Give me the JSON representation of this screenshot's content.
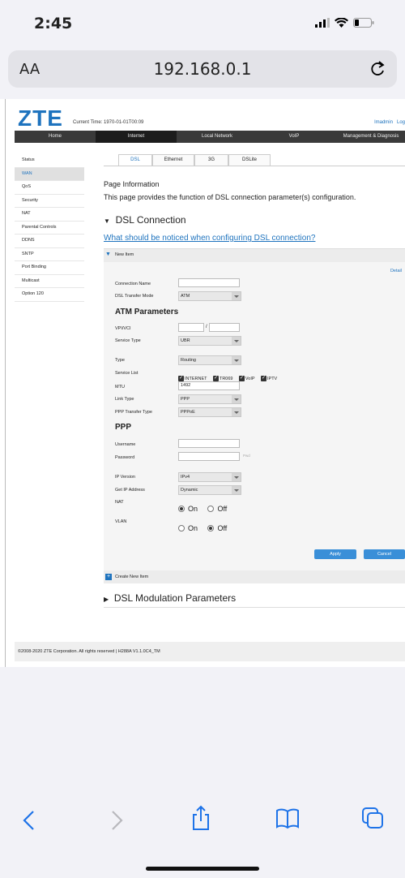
{
  "status": {
    "time": "2:45"
  },
  "browser": {
    "aa_label": "AA",
    "url": "192.168.0.1"
  },
  "header": {
    "logo": "ZTE",
    "current_time": "Current Time: 1970-01-01T00:09",
    "user": "lmadmin",
    "logout": "Log"
  },
  "nav": [
    {
      "label": "Home",
      "active": false
    },
    {
      "label": "Internet",
      "active": true
    },
    {
      "label": "Local Network",
      "active": false
    },
    {
      "label": "VoIP",
      "active": false
    },
    {
      "label": "Management & Diagnosis",
      "active": false
    }
  ],
  "sidebar": [
    "Status",
    "WAN",
    "QoS",
    "Security",
    "NAT",
    "Parental Controls",
    "DDNS",
    "SNTP",
    "Port Binding",
    "Multicast",
    "Option 120"
  ],
  "sidebar_active": "WAN",
  "tabs": [
    "DSL",
    "Ethernet",
    "3G",
    "DSLite"
  ],
  "page_info": {
    "title": "Page Information",
    "desc": "This page provides the function of DSL connection parameter(s) configuration."
  },
  "dsl_connection": {
    "title": "DSL Connection",
    "link": "What should be noticed when configuring DSL connection?"
  },
  "new_item": {
    "label": "New Item",
    "detail": "Detail"
  },
  "form": {
    "connection_name_label": "Connection Name",
    "connection_name_value": "",
    "dsl_mode_label": "DSL Transfer Mode",
    "dsl_mode_value": "ATM",
    "atm_title": "ATM Parameters",
    "vpivci_label": "VPI/VCI",
    "vpivci_sep": "/",
    "service_type_label": "Service Type",
    "service_type_value": "UBR",
    "type_label": "Type",
    "type_value": "Routing",
    "service_list_label": "Service List",
    "service_list": [
      "INTERNET",
      "TR069",
      "VoIP",
      "IPTV"
    ],
    "mtu_label": "MTU",
    "mtu_value": "1492",
    "link_type_label": "Link Type",
    "link_type_value": "PPP",
    "ppp_transfer_label": "PPP Transfer Type",
    "ppp_transfer_value": "PPPoE",
    "ppp_title": "PPP",
    "username_label": "Username",
    "password_label": "Password",
    "password_hint": "Pwd",
    "ip_version_label": "IP Version",
    "ip_version_value": "IPv4",
    "get_ip_label": "Get IP Address",
    "get_ip_value": "Dynamic",
    "nat_label": "NAT",
    "vlan_label": "VLAN",
    "on": "On",
    "off": "Off",
    "nat_state": "On",
    "vlan_state": "Off"
  },
  "buttons": {
    "apply": "Apply",
    "cancel": "Cancel"
  },
  "create_new": "Create New Item",
  "dsl_modulation": "DSL Modulation Parameters",
  "footer": "©2008-2020 ZTE Corporation. All rights reserved  |   H288A V1.1.0C4_TM",
  "colors": {
    "accent": "#1e73be",
    "button": "#3a8fd8"
  }
}
